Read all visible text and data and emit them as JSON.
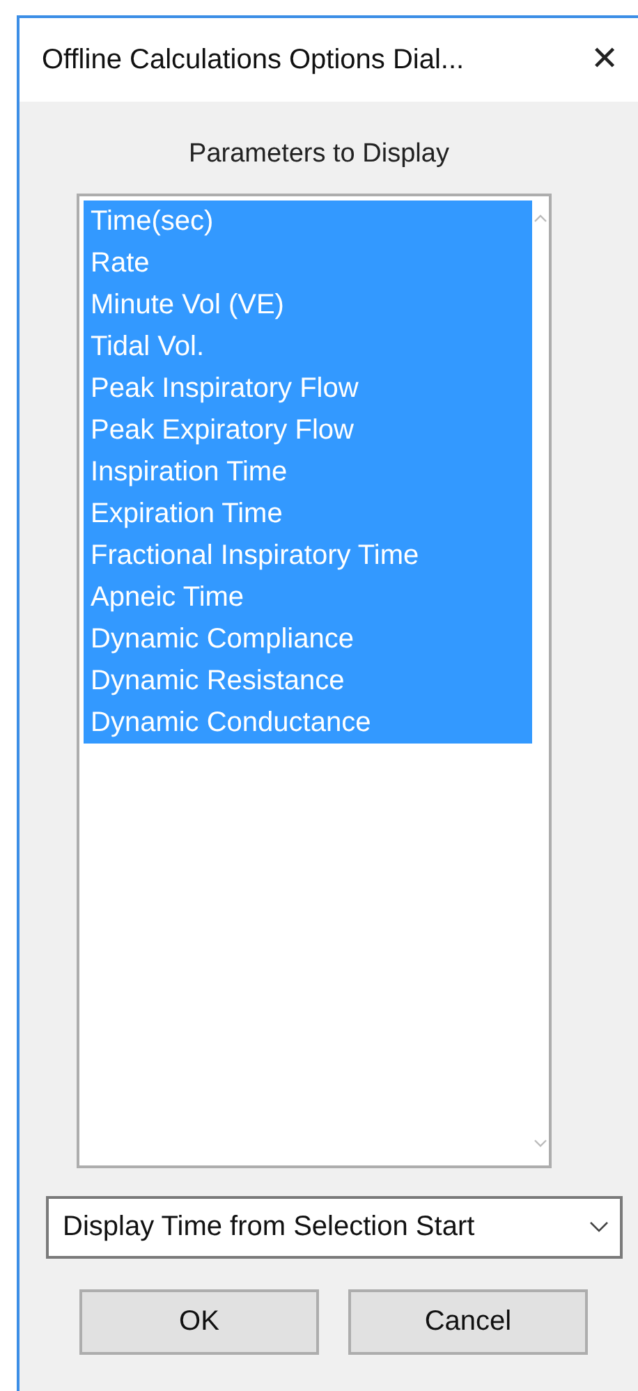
{
  "window": {
    "title": "Offline Calculations Options Dial...",
    "close": "✕"
  },
  "label": "Parameters to Display",
  "parameters": [
    {
      "label": "Time(sec)",
      "selected": true
    },
    {
      "label": "Rate",
      "selected": true
    },
    {
      "label": "Minute Vol (VE)",
      "selected": true
    },
    {
      "label": "Tidal Vol.",
      "selected": true
    },
    {
      "label": "Peak Inspiratory Flow",
      "selected": true
    },
    {
      "label": "Peak Expiratory Flow",
      "selected": true
    },
    {
      "label": "Inspiration Time",
      "selected": true
    },
    {
      "label": "Expiration Time",
      "selected": true
    },
    {
      "label": "Fractional Inspiratory Time",
      "selected": true
    },
    {
      "label": "Apneic Time",
      "selected": true
    },
    {
      "label": "Dynamic Compliance",
      "selected": true
    },
    {
      "label": "Dynamic Resistance",
      "selected": true
    },
    {
      "label": "Dynamic Conductance",
      "selected": true
    }
  ],
  "time_mode": {
    "value": "Display Time from Selection Start"
  },
  "buttons": [
    "OK",
    "Cancel"
  ]
}
